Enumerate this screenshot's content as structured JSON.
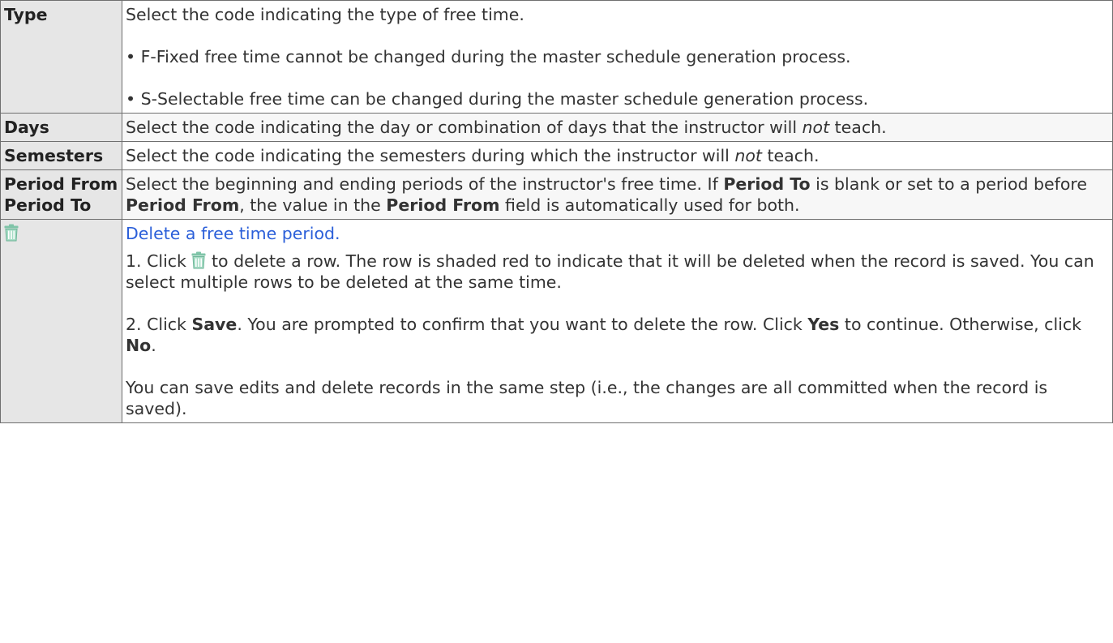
{
  "rows": {
    "type": {
      "label": "Type",
      "desc": "Select the code indicating the type of free time.",
      "bullet_fixed": "• F-Fixed free time cannot be changed during the master schedule generation process.",
      "bullet_selectable": "• S-Selectable free time can be changed during the master schedule generation process."
    },
    "days": {
      "label": "Days",
      "desc_before": "Select the code indicating the day or combination of days that the instructor will ",
      "desc_em": "not",
      "desc_after": " teach."
    },
    "semesters": {
      "label": "Semesters",
      "desc_before": "Select the code indicating the semesters during which the instructor will ",
      "desc_em": "not",
      "desc_after": " teach."
    },
    "period": {
      "label_from": "Period From",
      "label_to": "Period To",
      "t1": "Select the beginning and ending periods of the instructor's free time. If ",
      "b1": "Period To",
      "t2": " is blank or set to a period before ",
      "b2": "Period From",
      "t3": ", the value in the ",
      "b3": "Period From",
      "t4": " field is automatically used for both."
    },
    "delete": {
      "icon": "trash-icon",
      "link": "Delete a free time period.",
      "step1_before": "1. Click ",
      "step1_after": " to delete a row. The row is shaded red to indicate that it will be deleted when the record is saved. You can select multiple rows to be deleted at the same time.",
      "step2_a": "2. Click ",
      "step2_save": "Save",
      "step2_b": ". You are prompted to confirm that you want to delete the row. Click ",
      "step2_yes": "Yes",
      "step2_c": " to continue. Otherwise, click ",
      "step2_no": "No",
      "step2_d": ".",
      "note": "You can save edits and delete records in the same step (i.e., the changes are all committed when the record is saved)."
    }
  },
  "colors": {
    "label_bg": "#e6e6e6",
    "border": "#6f6f6f",
    "link": "#2b5fd9",
    "icon": "#7fc4a8"
  }
}
